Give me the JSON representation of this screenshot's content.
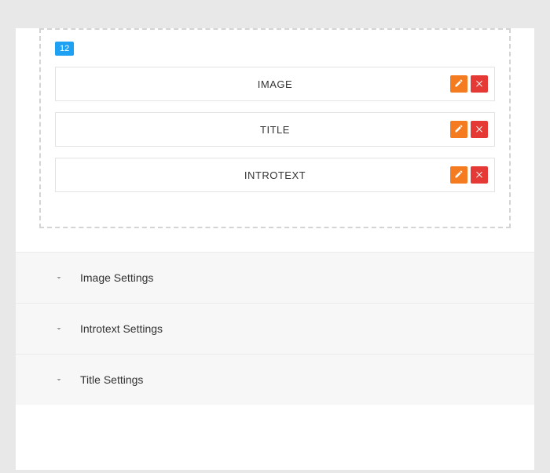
{
  "layout": {
    "column_width": "12",
    "blocks": [
      {
        "label": "IMAGE"
      },
      {
        "label": "TITLE"
      },
      {
        "label": "INTROTEXT"
      }
    ]
  },
  "settings": {
    "panels": [
      {
        "label": "Image Settings"
      },
      {
        "label": "Introtext Settings"
      },
      {
        "label": "Title Settings"
      }
    ]
  },
  "icons": {
    "edit": "pencil-icon",
    "delete": "close-icon",
    "expand": "chevron-down-icon"
  }
}
